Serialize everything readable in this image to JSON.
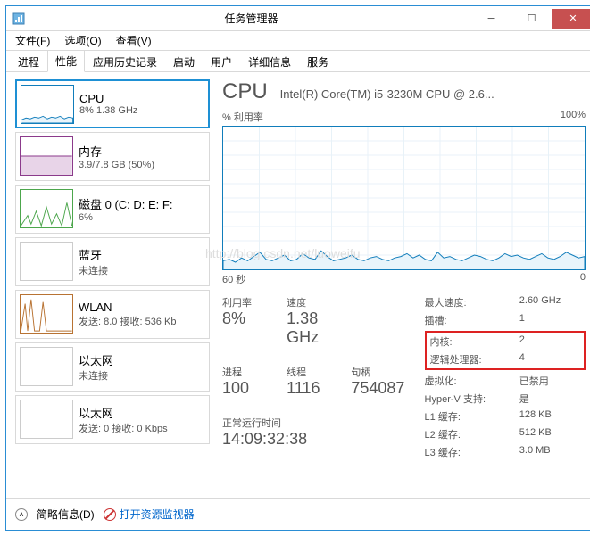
{
  "window": {
    "title": "任务管理器"
  },
  "menu": {
    "file": "文件(F)",
    "options": "选项(O)",
    "view": "查看(V)"
  },
  "tabs": {
    "processes": "进程",
    "performance": "性能",
    "app_history": "应用历史记录",
    "startup": "启动",
    "users": "用户",
    "details": "详细信息",
    "services": "服务"
  },
  "sidebar": [
    {
      "title": "CPU",
      "sub": "8% 1.38 GHz"
    },
    {
      "title": "内存",
      "sub": "3.9/7.8 GB (50%)"
    },
    {
      "title": "磁盘 0 (C: D: E: F:",
      "sub": "6%"
    },
    {
      "title": "蓝牙",
      "sub": "未连接"
    },
    {
      "title": "WLAN",
      "sub": "发送: 8.0 接收: 536 Kb"
    },
    {
      "title": "以太网",
      "sub": "未连接"
    },
    {
      "title": "以太网",
      "sub": "发送: 0 接收: 0 Kbps"
    }
  ],
  "main": {
    "heading": "CPU",
    "cpu_name": "Intel(R) Core(TM) i5-3230M CPU @ 2.6...",
    "chart_label_left": "% 利用率",
    "chart_label_right": "100%",
    "chart_bottom_left": "60 秒",
    "chart_bottom_right": "0",
    "stats": {
      "util_label": "利用率",
      "util_value": "8%",
      "speed_label": "速度",
      "speed_value": "1.38 GHz",
      "proc_label": "进程",
      "proc_value": "100",
      "thread_label": "线程",
      "thread_value": "1116",
      "handle_label": "句柄",
      "handle_value": "754087",
      "uptime_label": "正常运行时间",
      "uptime_value": "14:09:32:38"
    },
    "right": {
      "max_speed_label": "最大速度:",
      "max_speed_value": "2.60 GHz",
      "sockets_label": "插槽:",
      "sockets_value": "1",
      "cores_label": "内核:",
      "cores_value": "2",
      "logical_label": "逻辑处理器:",
      "logical_value": "4",
      "virt_label": "虚拟化:",
      "virt_value": "已禁用",
      "hyperv_label": "Hyper-V 支持:",
      "hyperv_value": "是",
      "l1_label": "L1 缓存:",
      "l1_value": "128 KB",
      "l2_label": "L2 缓存:",
      "l2_value": "512 KB",
      "l3_label": "L3 缓存:",
      "l3_value": "3.0 MB"
    }
  },
  "statusbar": {
    "brief": "简略信息(D)",
    "monitor": "打开资源监视器"
  },
  "chart_data": {
    "type": "line",
    "title": "% 利用率",
    "xlabel": "秒",
    "ylabel": "%",
    "xlim": [
      60,
      0
    ],
    "ylim": [
      0,
      100
    ],
    "series": [
      {
        "name": "CPU",
        "values": [
          6,
          7,
          5,
          8,
          6,
          9,
          12,
          7,
          6,
          8,
          10,
          6,
          7,
          11,
          8,
          7,
          13,
          9,
          6,
          7,
          8,
          10,
          7,
          6,
          8,
          9,
          7,
          6,
          8,
          9,
          11,
          8,
          10,
          7,
          6,
          12,
          8,
          9,
          7,
          6,
          8,
          10,
          9,
          7,
          6,
          8,
          11,
          9,
          10,
          8,
          7,
          9,
          11,
          8,
          7,
          9,
          12,
          10,
          8,
          9
        ]
      }
    ]
  }
}
